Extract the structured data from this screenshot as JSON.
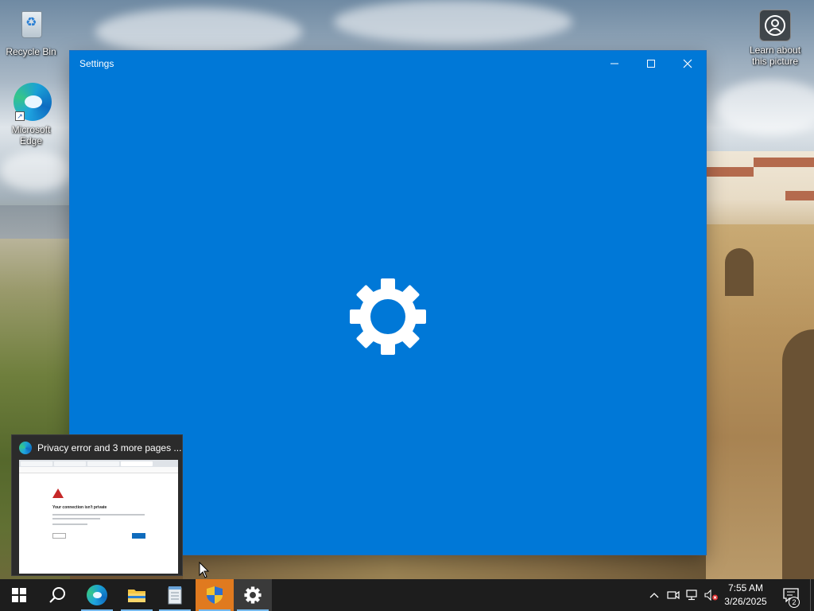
{
  "desktop": {
    "icons": [
      {
        "label": "Recycle Bin",
        "icon": "recycle-bin-icon"
      },
      {
        "label": "Microsoft Edge",
        "icon": "edge-icon"
      }
    ],
    "learn_icon": {
      "label": "Learn about this picture",
      "icon": "camera-icon"
    }
  },
  "settings_window": {
    "title": "Settings",
    "accent_color": "#0078d7",
    "splash_icon": "gear-icon",
    "controls": [
      "minimize",
      "maximize",
      "close"
    ]
  },
  "taskbar_preview": {
    "title": "Privacy error and 3 more pages ...",
    "thumbnail_heading": "Your connection isn't private"
  },
  "taskbar": {
    "buttons": [
      {
        "name": "start",
        "icon": "windows-logo-icon"
      },
      {
        "name": "search",
        "icon": "search-icon"
      },
      {
        "name": "edge",
        "icon": "edge-icon",
        "running": true
      },
      {
        "name": "file-explorer",
        "icon": "folder-icon",
        "running": true
      },
      {
        "name": "notepad",
        "icon": "notepad-icon",
        "running": true
      },
      {
        "name": "installer",
        "icon": "shield-icon",
        "running": true,
        "active": true
      },
      {
        "name": "settings",
        "icon": "gear-icon",
        "running": true
      }
    ],
    "tray": {
      "icons": [
        "chevron-up-icon",
        "meet-now-icon",
        "network-icon",
        "volume-muted-icon"
      ],
      "time": "7:55 AM",
      "date": "3/26/2025",
      "notification_count": "2"
    }
  }
}
